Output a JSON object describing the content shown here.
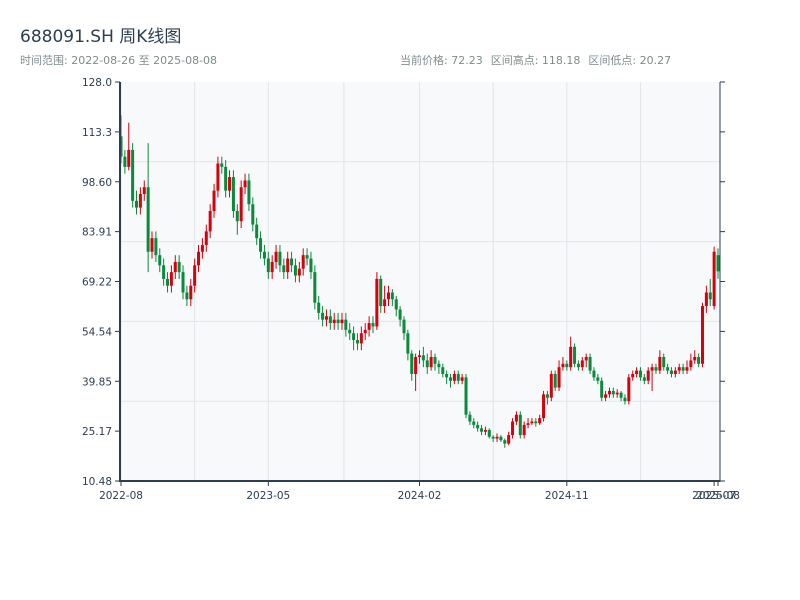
{
  "header": {
    "title": "688091.SH 周K线图",
    "range_text": "时间范围: 2022-08-26 至 2025-08-08",
    "current_price": "当前价格: 72.23",
    "range_high": "区间高点: 118.18",
    "range_low": "区间低点: 20.27"
  },
  "chart_data": {
    "type": "candlestick",
    "title": "688091.SH 周K线图",
    "period": "weekly",
    "start_date": "2022-08-26",
    "end_date": "2025-08-08",
    "ylim": [
      10.48,
      128.0
    ],
    "yticks": [
      "10.48",
      "25.17",
      "39.85",
      "54.54",
      "69.22",
      "83.91",
      "98.60",
      "113.3",
      "128.0"
    ],
    "xticks": [
      {
        "label": "2022-08",
        "index": 0
      },
      {
        "label": "2023-05",
        "index": 38
      },
      {
        "label": "2024-02",
        "index": 77
      },
      {
        "label": "2024-11",
        "index": 115
      },
      {
        "label": "2025-07",
        "index": 153
      },
      {
        "label": "2025-08",
        "index": 154
      }
    ],
    "colors": {
      "up": "#d9000d",
      "down": "#0a8a3a",
      "background": "#f7f9fb",
      "grid": "#e1e5ea",
      "axis": "#2c3e50"
    },
    "grid": true,
    "ohlc_fields": [
      "open",
      "high",
      "low",
      "close"
    ],
    "candles": [
      [
        112,
        118.18,
        104,
        106
      ],
      [
        106,
        108,
        101,
        103
      ],
      [
        103,
        116,
        102,
        108
      ],
      [
        108,
        110,
        91,
        93
      ],
      [
        93,
        96,
        89,
        91
      ],
      [
        91,
        97,
        89,
        95
      ],
      [
        95,
        99,
        93,
        97
      ],
      [
        97,
        110,
        72,
        78
      ],
      [
        78,
        84,
        76,
        82
      ],
      [
        82,
        84,
        75,
        77
      ],
      [
        77,
        79,
        72,
        74
      ],
      [
        74,
        76,
        68,
        70
      ],
      [
        70,
        72,
        66,
        68
      ],
      [
        68,
        74,
        66,
        72
      ],
      [
        72,
        77,
        70,
        75
      ],
      [
        75,
        77,
        70,
        72
      ],
      [
        72,
        74,
        64,
        66
      ],
      [
        66,
        68,
        62,
        64
      ],
      [
        64,
        70,
        62,
        68
      ],
      [
        68,
        76,
        66,
        74
      ],
      [
        74,
        80,
        72,
        78
      ],
      [
        78,
        82,
        76,
        80
      ],
      [
        80,
        86,
        78,
        84
      ],
      [
        84,
        92,
        82,
        90
      ],
      [
        90,
        98,
        88,
        96
      ],
      [
        96,
        106,
        94,
        104
      ],
      [
        104,
        106,
        101,
        103
      ],
      [
        103,
        105,
        94,
        96
      ],
      [
        96,
        102,
        94,
        100
      ],
      [
        100,
        102,
        88,
        90
      ],
      [
        90,
        92,
        83,
        87
      ],
      [
        87,
        99,
        85,
        97
      ],
      [
        97,
        101,
        95,
        99
      ],
      [
        99,
        101,
        90,
        92
      ],
      [
        92,
        94,
        84,
        86
      ],
      [
        86,
        88,
        80,
        82
      ],
      [
        82,
        84,
        76,
        78
      ],
      [
        78,
        80,
        74,
        76
      ],
      [
        76,
        78,
        70,
        72
      ],
      [
        72,
        77,
        70,
        75
      ],
      [
        75,
        80,
        73,
        78
      ],
      [
        78,
        80,
        72,
        74
      ],
      [
        74,
        76,
        70,
        72
      ],
      [
        72,
        78,
        70,
        76
      ],
      [
        76,
        78,
        72,
        74
      ],
      [
        74,
        76,
        69,
        71
      ],
      [
        71,
        75,
        69,
        73
      ],
      [
        73,
        79,
        71,
        77
      ],
      [
        77,
        79,
        74,
        76
      ],
      [
        76,
        78,
        70,
        72
      ],
      [
        72,
        74,
        61,
        63
      ],
      [
        63,
        65,
        58,
        60
      ],
      [
        60,
        62,
        56,
        58
      ],
      [
        58,
        61,
        56,
        59
      ],
      [
        59,
        61,
        55,
        57
      ],
      [
        57,
        60,
        55,
        58
      ],
      [
        58,
        60,
        55,
        57
      ],
      [
        57,
        60,
        55,
        58
      ],
      [
        58,
        60,
        53,
        55
      ],
      [
        55,
        57,
        52,
        54
      ],
      [
        54,
        56,
        49,
        52
      ],
      [
        52,
        54,
        49,
        51
      ],
      [
        51,
        56,
        49,
        54
      ],
      [
        54,
        57,
        52,
        55
      ],
      [
        55,
        59,
        53,
        57
      ],
      [
        57,
        59,
        54,
        56
      ],
      [
        56,
        72,
        55,
        70
      ],
      [
        70,
        71,
        60,
        62
      ],
      [
        62,
        68,
        60,
        64
      ],
      [
        64,
        68,
        62,
        66
      ],
      [
        66,
        67,
        62,
        64
      ],
      [
        64,
        65,
        59,
        61
      ],
      [
        61,
        62,
        56,
        58
      ],
      [
        58,
        59,
        52,
        54
      ],
      [
        54,
        55,
        46,
        48
      ],
      [
        48,
        49,
        40,
        42
      ],
      [
        42,
        48,
        37,
        47
      ],
      [
        47,
        49,
        45,
        47.5
      ],
      [
        47.5,
        50,
        44,
        46
      ],
      [
        46,
        48,
        42,
        44
      ],
      [
        44,
        49,
        43,
        47
      ],
      [
        47,
        48,
        43,
        45
      ],
      [
        45,
        46,
        42,
        44
      ],
      [
        44,
        45,
        41,
        42
      ],
      [
        42,
        43,
        39,
        41
      ],
      [
        41,
        42,
        38,
        40
      ],
      [
        40,
        43,
        39,
        42
      ],
      [
        42,
        43,
        39,
        40
      ],
      [
        40,
        42,
        39,
        41
      ],
      [
        41,
        42,
        29,
        30
      ],
      [
        30,
        31,
        27,
        28
      ],
      [
        28,
        29,
        26,
        27
      ],
      [
        27,
        28,
        25,
        26
      ],
      [
        26,
        27,
        24,
        25
      ],
      [
        25,
        26.5,
        24,
        25.5
      ],
      [
        25.5,
        26,
        23,
        23.5
      ],
      [
        23.5,
        24,
        22,
        23
      ],
      [
        23,
        24.5,
        22,
        23.5
      ],
      [
        23.5,
        24,
        22,
        22.5
      ],
      [
        22.5,
        23,
        20.27,
        21.5
      ],
      [
        21.5,
        25,
        21,
        24
      ],
      [
        24,
        29,
        23,
        28
      ],
      [
        28,
        31,
        27,
        30
      ],
      [
        30,
        31,
        23,
        24
      ],
      [
        24,
        28,
        23,
        27
      ],
      [
        27,
        29,
        26,
        27.5
      ],
      [
        27.5,
        29,
        27,
        28
      ],
      [
        28,
        29,
        26.5,
        27.5
      ],
      [
        27.5,
        30,
        27,
        29
      ],
      [
        29,
        37,
        28,
        36
      ],
      [
        36,
        37,
        33,
        35
      ],
      [
        35,
        43,
        34,
        42
      ],
      [
        42,
        43,
        37,
        38
      ],
      [
        38,
        46,
        37,
        44
      ],
      [
        44,
        47,
        43,
        45
      ],
      [
        45,
        46,
        43,
        44
      ],
      [
        44,
        53,
        43,
        50
      ],
      [
        50,
        51,
        44,
        45
      ],
      [
        45,
        46,
        43,
        44
      ],
      [
        44,
        47,
        43,
        46
      ],
      [
        46,
        48,
        44,
        47
      ],
      [
        47,
        48,
        42,
        43
      ],
      [
        43,
        44,
        40,
        41
      ],
      [
        41,
        42,
        39,
        40
      ],
      [
        40,
        41,
        34,
        35
      ],
      [
        35,
        37,
        34,
        36
      ],
      [
        36,
        38,
        35,
        37
      ],
      [
        37,
        38,
        35,
        36
      ],
      [
        36,
        37.5,
        35,
        36.5
      ],
      [
        36.5,
        37,
        34,
        35
      ],
      [
        35,
        36,
        33,
        34
      ],
      [
        34,
        42,
        33,
        41
      ],
      [
        41,
        43,
        40,
        42
      ],
      [
        42,
        44,
        41,
        43
      ],
      [
        43,
        44,
        40,
        41
      ],
      [
        41,
        42,
        39,
        40
      ],
      [
        40,
        44,
        39,
        43
      ],
      [
        43,
        45,
        37,
        44
      ],
      [
        44,
        45,
        42,
        43
      ],
      [
        43,
        49,
        42,
        47
      ],
      [
        47,
        48,
        43,
        44
      ],
      [
        44,
        45,
        42,
        43
      ],
      [
        43,
        44,
        41,
        42
      ],
      [
        42,
        44,
        41,
        43
      ],
      [
        43,
        45,
        42,
        44
      ],
      [
        44,
        45,
        42,
        43
      ],
      [
        43,
        46,
        42,
        44
      ],
      [
        44,
        48,
        43,
        46
      ],
      [
        46,
        49,
        45,
        47
      ],
      [
        47,
        48,
        44,
        45
      ],
      [
        45,
        63,
        44,
        62
      ],
      [
        62,
        68,
        60,
        66
      ],
      [
        66,
        70,
        62,
        64
      ],
      [
        62,
        79.5,
        61,
        78
      ],
      [
        77,
        79,
        70,
        72.23
      ]
    ]
  }
}
